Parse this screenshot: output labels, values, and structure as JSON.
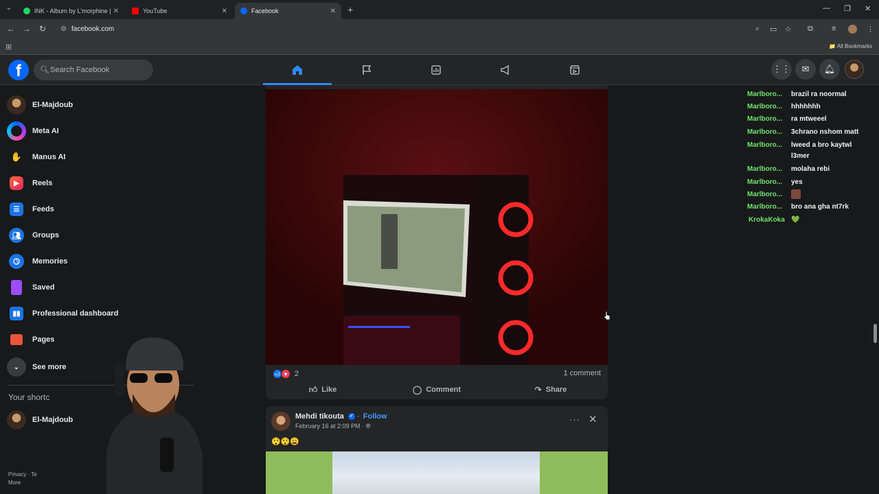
{
  "browser": {
    "tabs": [
      {
        "title": "INK - Album by L'morphine | Sp",
        "color": "#1ed760"
      },
      {
        "title": "YouTube",
        "color": "#ff0000"
      },
      {
        "title": "Facebook",
        "color": "#0866ff"
      }
    ],
    "url": "facebook.com",
    "bookmarks_label": "All Bookmarks"
  },
  "header": {
    "search_placeholder": "Search Facebook"
  },
  "sidebar": {
    "items": [
      {
        "label": "El-Majdoub"
      },
      {
        "label": "Meta AI"
      },
      {
        "label": "Manus AI"
      },
      {
        "label": "Reels"
      },
      {
        "label": "Feeds"
      },
      {
        "label": "Groups"
      },
      {
        "label": "Memories"
      },
      {
        "label": "Saved"
      },
      {
        "label": "Professional dashboard"
      },
      {
        "label": "Pages"
      },
      {
        "label": "See more"
      }
    ],
    "shortcuts_heading": "Your shortc",
    "shortcut_item": "El-Majdoub",
    "footer": [
      "Privacy · Te",
      "More"
    ]
  },
  "post": {
    "reaction_count": "2",
    "comments": "1 comment",
    "actions": {
      "like": "Like",
      "comment": "Comment",
      "share": "Share"
    }
  },
  "post2": {
    "author": "Mehdi tikouta",
    "follow": "Follow",
    "timestamp": "February 16 at 2:09 PM ·",
    "text": "😲😲😩"
  },
  "chat": [
    {
      "user": "Marlboro...",
      "msg": "brazil ra noormal"
    },
    {
      "user": "Marlboro...",
      "msg": "hhhhhhh"
    },
    {
      "user": "Marlboro...",
      "msg": "ra mtweeel"
    },
    {
      "user": "Marlboro...",
      "msg": "3chrano nshom matt"
    },
    {
      "user": "Marlboro...",
      "msg": "lweed a bro kaytwl l3mer"
    },
    {
      "user": "Marlboro...",
      "msg": "molaha rebi"
    },
    {
      "user": "Marlboro...",
      "msg": "yes"
    },
    {
      "user": "Marlboro...",
      "msg": ""
    },
    {
      "user": "Marlboro...",
      "msg": "bro ana gha nt7rk"
    },
    {
      "user": "KrokaKoka",
      "msg": "💚"
    }
  ]
}
